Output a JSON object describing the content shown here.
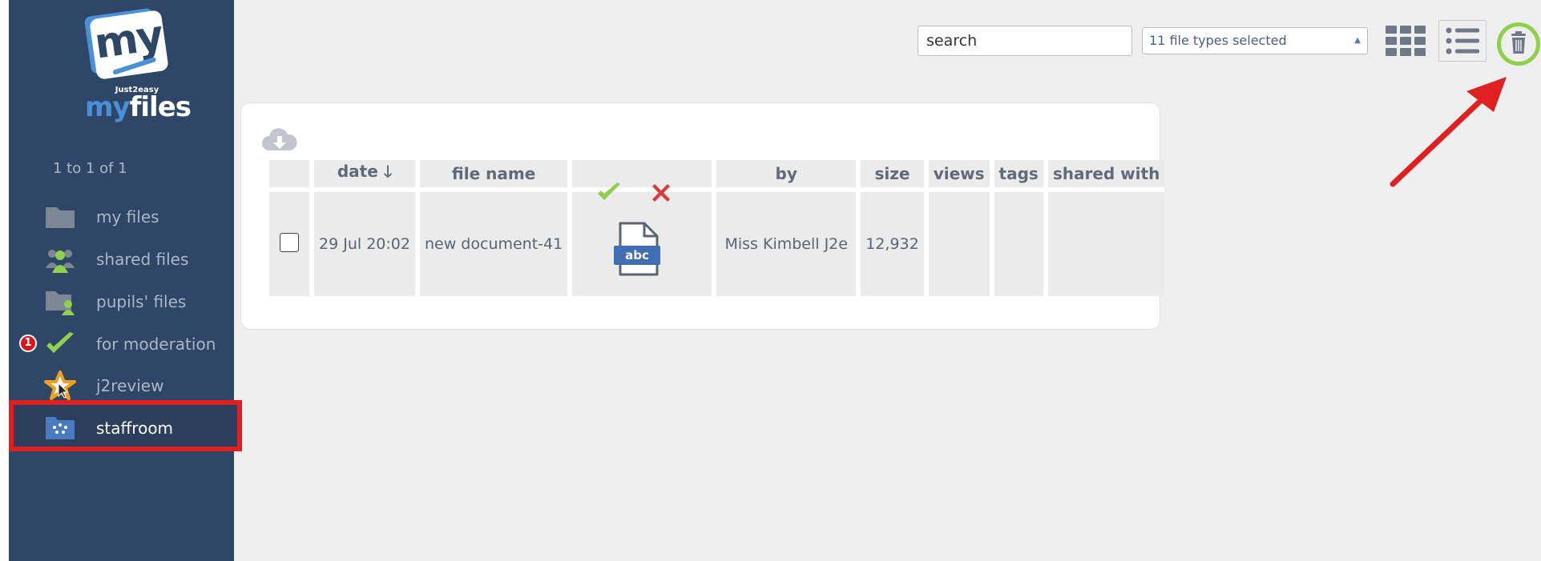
{
  "logo": {
    "big": "my",
    "sub": "Just2easy",
    "main_a": "my",
    "main_b": "files"
  },
  "sidebar": {
    "count": "1 to 1 of 1",
    "items": [
      {
        "label": "my files",
        "icon": "folder-icon"
      },
      {
        "label": "shared files",
        "icon": "users-icon"
      },
      {
        "label": "pupils' files",
        "icon": "pupil-folder-icon"
      },
      {
        "label": "for moderation",
        "icon": "check-icon",
        "badge": "1"
      },
      {
        "label": "j2review",
        "icon": "star-icon"
      },
      {
        "label": "staffroom",
        "icon": "staffroom-icon",
        "active": true
      }
    ]
  },
  "toolbar": {
    "search_placeholder": "search",
    "filetypes_value": "11 file types selected",
    "icons": [
      "grid-view-icon",
      "list-view-icon",
      "trash-icon"
    ]
  },
  "table": {
    "headers": [
      "date",
      "file name",
      "by",
      "size",
      "views",
      "tags",
      "shared with"
    ],
    "sort_icon": "arrow-down-icon",
    "rows": [
      {
        "date": "29 Jul 20:02",
        "name": "new document-41",
        "thumb_text": "abc",
        "by": "Miss Kimbell J2e",
        "size": "12,932",
        "views": "",
        "tags": "",
        "shared": ""
      }
    ]
  },
  "colors": {
    "sidebar": "#2f4766",
    "accent_green": "#8fd14f",
    "highlight_red": "#e02020"
  }
}
